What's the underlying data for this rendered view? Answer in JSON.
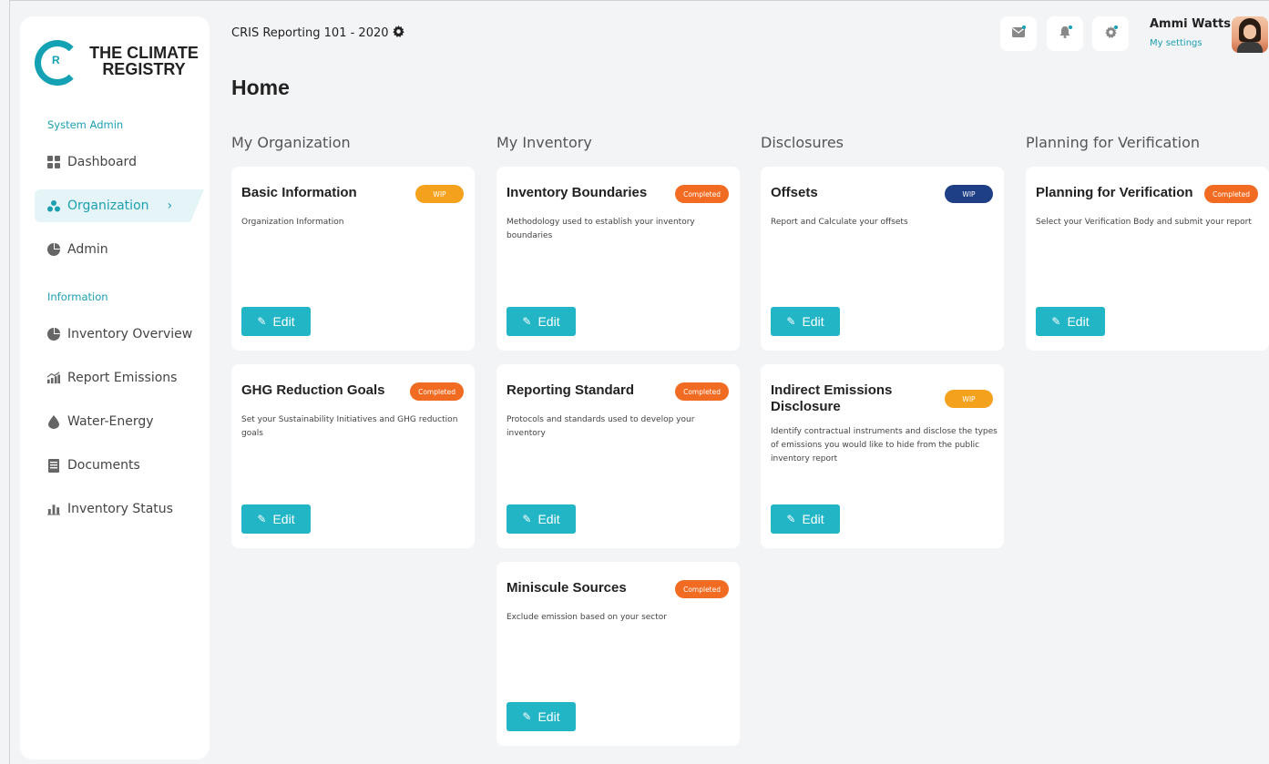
{
  "brand": {
    "mark_letter": "R",
    "name_line1": "THE CLIMATE",
    "name_line2": "REGISTRY",
    "color": "#14a1b4"
  },
  "sidebar": {
    "section_admin": "System Admin",
    "section_info": "Information",
    "items": [
      {
        "label": "Dashboard",
        "icon": "grid-icon"
      },
      {
        "label": "Organization",
        "icon": "org-icon",
        "active": true
      },
      {
        "label": "Admin",
        "icon": "pie-icon"
      },
      {
        "label": "Inventory Overview",
        "icon": "pie-icon"
      },
      {
        "label": "Report Emissions",
        "icon": "chart-icon"
      },
      {
        "label": "Water-Energy",
        "icon": "drop-icon"
      },
      {
        "label": "Documents",
        "icon": "document-icon"
      },
      {
        "label": "Inventory Status",
        "icon": "bar-chart-icon"
      }
    ]
  },
  "header": {
    "breadcrumb": "CRIS Reporting 101 - 2020",
    "page_title": "Home",
    "user_name": "Ammi Watts",
    "user_settings": "My settings"
  },
  "columns": [
    {
      "title": "My Organization"
    },
    {
      "title": "My Inventory"
    },
    {
      "title": "Disclosures"
    },
    {
      "title": "Planning for Verification"
    }
  ],
  "cards": {
    "basic_info": {
      "title": "Basic Information",
      "badge": "WIP",
      "desc": "Organization Information",
      "edit": "Edit"
    },
    "ghg_goals": {
      "title": "GHG Reduction Goals",
      "badge": "Completed",
      "desc": "Set your Sustainability Initiatives and GHG reduction goals",
      "edit": "Edit"
    },
    "inv_boundaries": {
      "title": "Inventory Boundaries",
      "badge": "Completed",
      "desc": "Methodology used to establish your inventory boundaries",
      "edit": "Edit"
    },
    "reporting_std": {
      "title": "Reporting Standard",
      "badge": "Completed",
      "desc": "Protocols and standards used to develop your inventory",
      "edit": "Edit"
    },
    "miniscule": {
      "title": "Miniscule Sources",
      "badge": "Completed",
      "desc": "Exclude emission based on your sector",
      "edit": "Edit"
    },
    "offsets": {
      "title": "Offsets",
      "badge": "WIP",
      "desc": "Report and Calculate your offsets",
      "edit": "Edit"
    },
    "indirect": {
      "title": "Indirect Emissions Disclosure",
      "badge": "WIP",
      "desc": "Identify contractual instruments and disclose the types of emissions you would like to hide from the public inventory report",
      "edit": "Edit"
    },
    "planning": {
      "title": "Planning for Verification",
      "badge": "Completed",
      "desc": "Select your Verification Body and submit your report",
      "edit": "Edit"
    }
  },
  "colors": {
    "wip": "#f4a21e",
    "completed": "#f26b22",
    "wip_dark": "#1e3f86",
    "edit": "#22b5c6",
    "accent": "#1c9fb0"
  }
}
